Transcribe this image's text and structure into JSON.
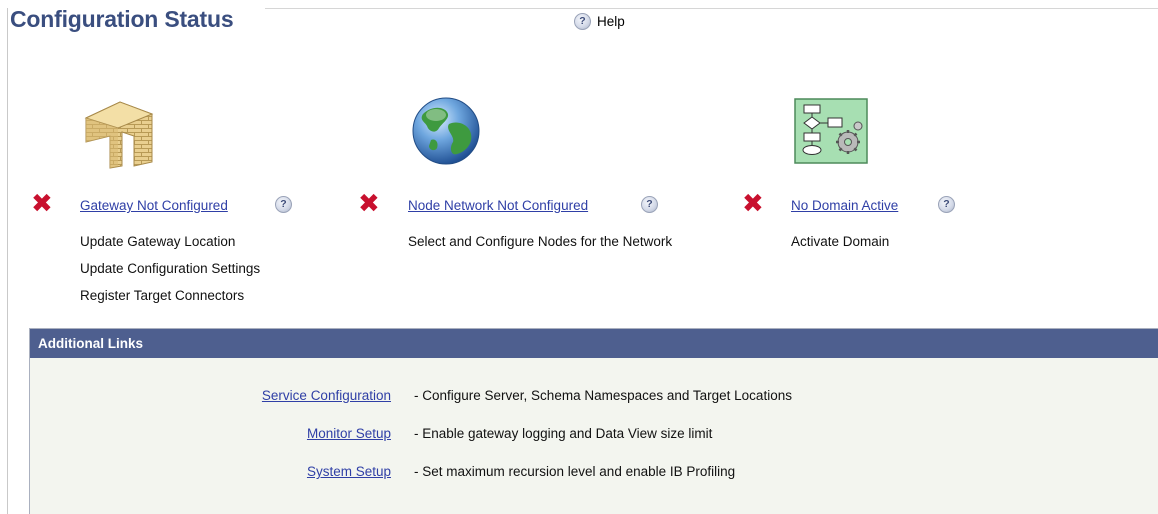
{
  "page": {
    "title": "Configuration Status",
    "help_label": "Help"
  },
  "statuses": [
    {
      "icon": "brick-wall-gateway-icon",
      "status_icon": "error-x-icon",
      "link": "Gateway Not Configured",
      "steps": [
        "Update Gateway Location",
        "Update Configuration Settings",
        "Register Target Connectors"
      ]
    },
    {
      "icon": "globe-icon",
      "status_icon": "error-x-icon",
      "link": "Node Network Not Configured",
      "steps": [
        "Select and Configure Nodes for the Network"
      ]
    },
    {
      "icon": "flowchart-gear-icon",
      "status_icon": "error-x-icon",
      "link": "No Domain Active",
      "steps": [
        "Activate Domain"
      ]
    }
  ],
  "additional_links": {
    "header": "Additional Links",
    "items": [
      {
        "label": "Service Configuration",
        "description": "- Configure Server, Schema Namespaces and Target Locations"
      },
      {
        "label": "Monitor Setup",
        "description": "- Enable gateway logging and Data View size limit"
      },
      {
        "label": "System Setup",
        "description": "- Set maximum recursion level and enable IB Profiling"
      }
    ]
  },
  "colors": {
    "title": "#3a4e7f",
    "link": "#2f3fa6",
    "error": "#c8102e",
    "panel_header": "#4e5f8f",
    "panel_body": "#f3f5ef"
  }
}
